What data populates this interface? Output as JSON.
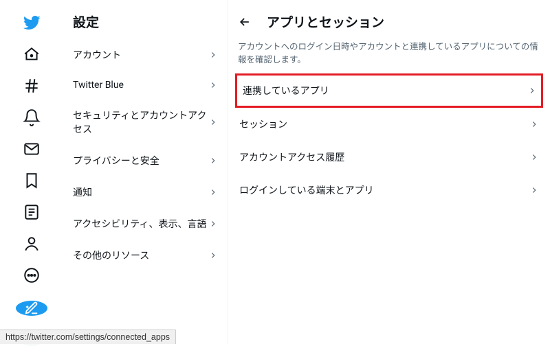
{
  "settings_title": "設定",
  "settings_items": [
    {
      "label": "アカウント"
    },
    {
      "label": "Twitter Blue"
    },
    {
      "label": "セキュリティとアカウントアクセス"
    },
    {
      "label": "プライバシーと安全"
    },
    {
      "label": "通知"
    },
    {
      "label": "アクセシビリティ、表示、言語"
    },
    {
      "label": "その他のリソース"
    }
  ],
  "main": {
    "title": "アプリとセッション",
    "description": "アカウントへのログイン日時やアカウントと連携しているアプリについての情報を確認します。",
    "items": [
      {
        "label": "連携しているアプリ",
        "highlight": true
      },
      {
        "label": "セッション"
      },
      {
        "label": "アカウントアクセス履歴"
      },
      {
        "label": "ログインしている端末とアプリ"
      }
    ]
  },
  "status_url": "https://twitter.com/settings/connected_apps"
}
